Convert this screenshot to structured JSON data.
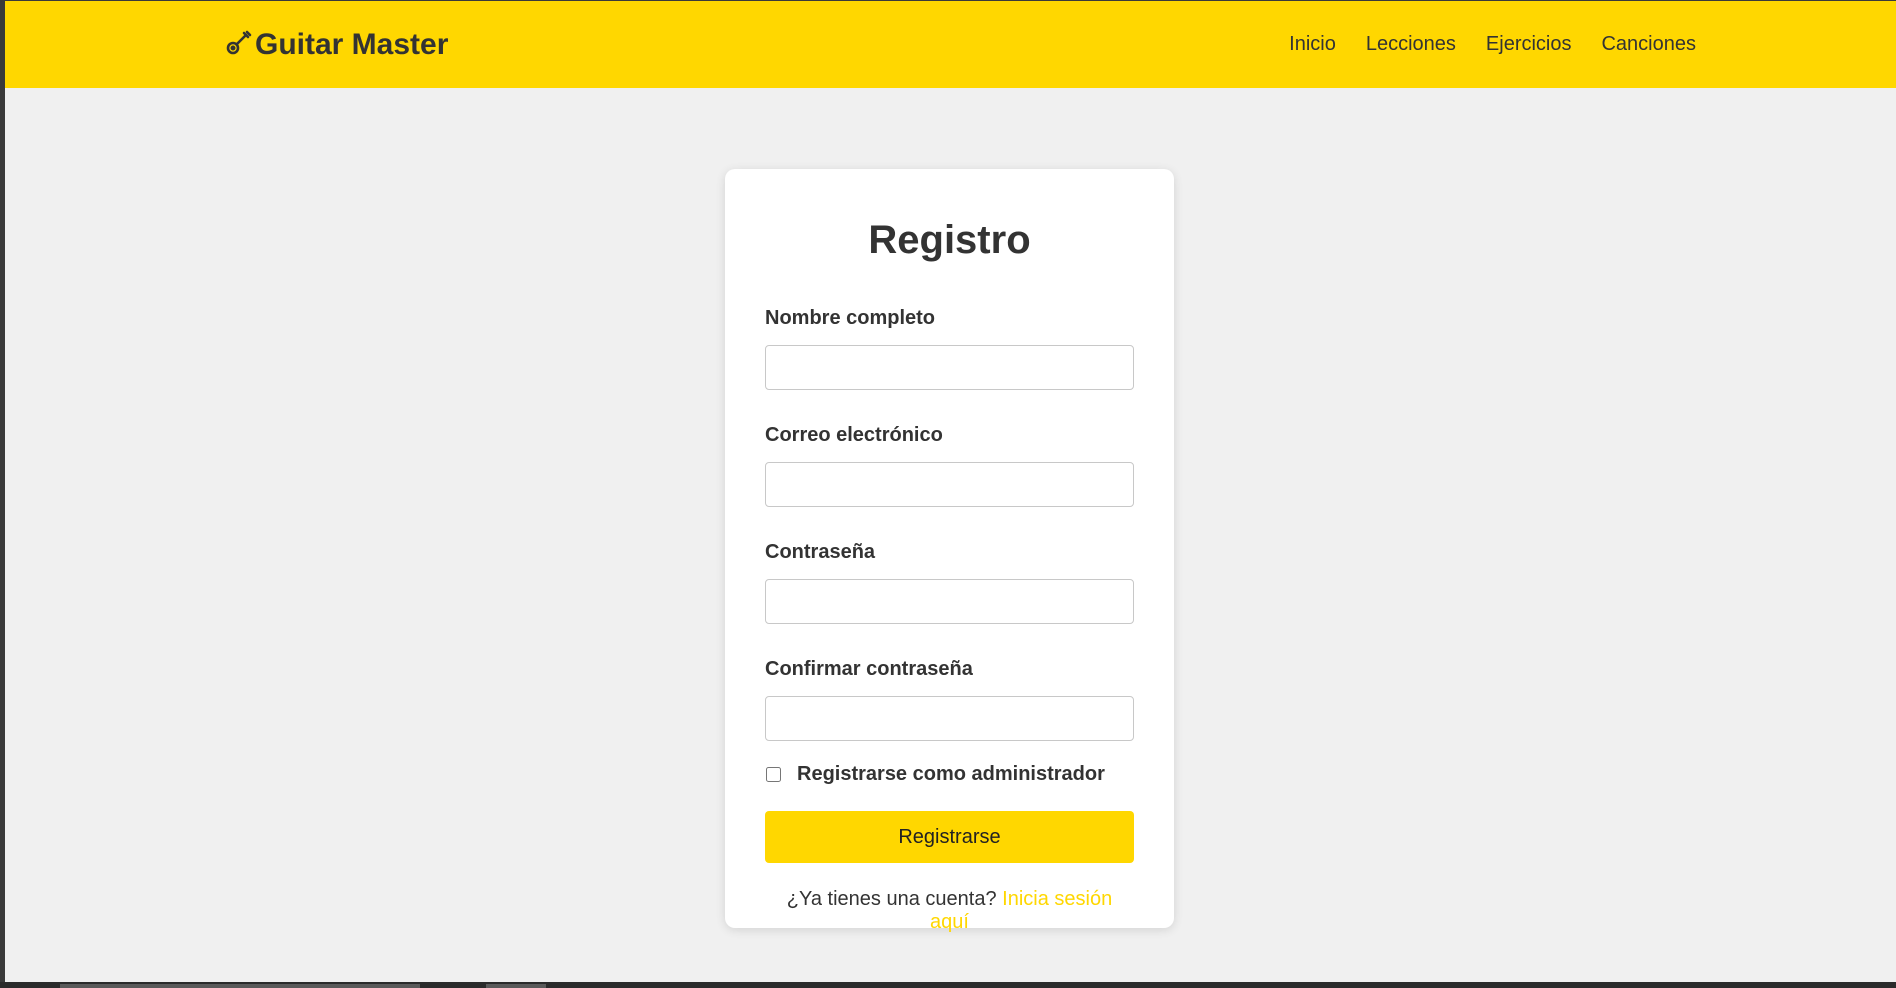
{
  "header": {
    "brand": "Guitar Master",
    "brand_icon": "guitar-icon",
    "nav": [
      "Inicio",
      "Lecciones",
      "Ejercicios",
      "Canciones"
    ]
  },
  "form": {
    "title": "Registro",
    "fields": [
      {
        "label": "Nombre completo",
        "value": "",
        "placeholder": ""
      },
      {
        "label": "Correo electrónico",
        "value": "",
        "placeholder": ""
      },
      {
        "label": "Contraseña",
        "value": "",
        "placeholder": ""
      },
      {
        "label": "Confirmar contraseña",
        "value": "",
        "placeholder": ""
      }
    ],
    "admin_checkbox_label": "Registrarse como administrador",
    "admin_checked": false,
    "submit_label": "Registrarse",
    "login_prompt": "¿Ya tienes una cuenta?",
    "login_link": "Inicia sesión aquí"
  },
  "colors": {
    "accent": "#ffd700",
    "background": "#f0f0f0",
    "text": "#333333"
  }
}
